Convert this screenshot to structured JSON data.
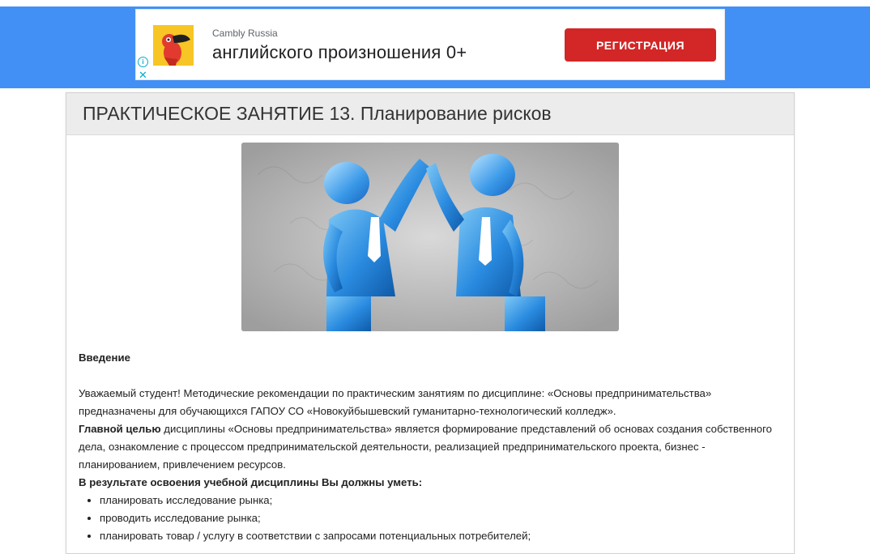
{
  "ad": {
    "advertiser": "Cambly Russia",
    "headline": "английского произношения 0+",
    "cta_label": "РЕГИСТРАЦИЯ",
    "info_glyph": "i",
    "close_glyph": "✕",
    "brand_color": "#d32626",
    "logo_icon": "toucan-icon"
  },
  "page": {
    "title": "ПРАКТИЧЕСКОЕ ЗАНЯТИЕ 13. Планирование рисков",
    "hero_image": "two-businessmen-high-five-image",
    "accent_color": "#4290f5"
  },
  "content": {
    "intro_heading": "Введение",
    "paragraph_1": "Уважаемый студент! Методические рекомендации по практическим занятиям по дисциплине: «Основы предпринимательства» предназначены для обучающихся ГАПОУ СО «Новокуйбышевский гуманитарно-технологический колледж».",
    "goal_label": "Главной  целью",
    "goal_text": "   дисциплины  «Основы предпринимательства» является формирование представлений об основах создания собственного дела, ознакомление с процессом предпринимательской деятельности, реализацией предпринимательского проекта, бизнес - планированием, привлечением ресурсов.",
    "skills_heading": "В результате освоения учебной дисциплины Вы должны уметь:",
    "skills": [
      "планировать исследование рынка;",
      "проводить исследование рынка;",
      "планировать товар / услугу в соответствии с запросами потенциальных потребителей;"
    ]
  }
}
